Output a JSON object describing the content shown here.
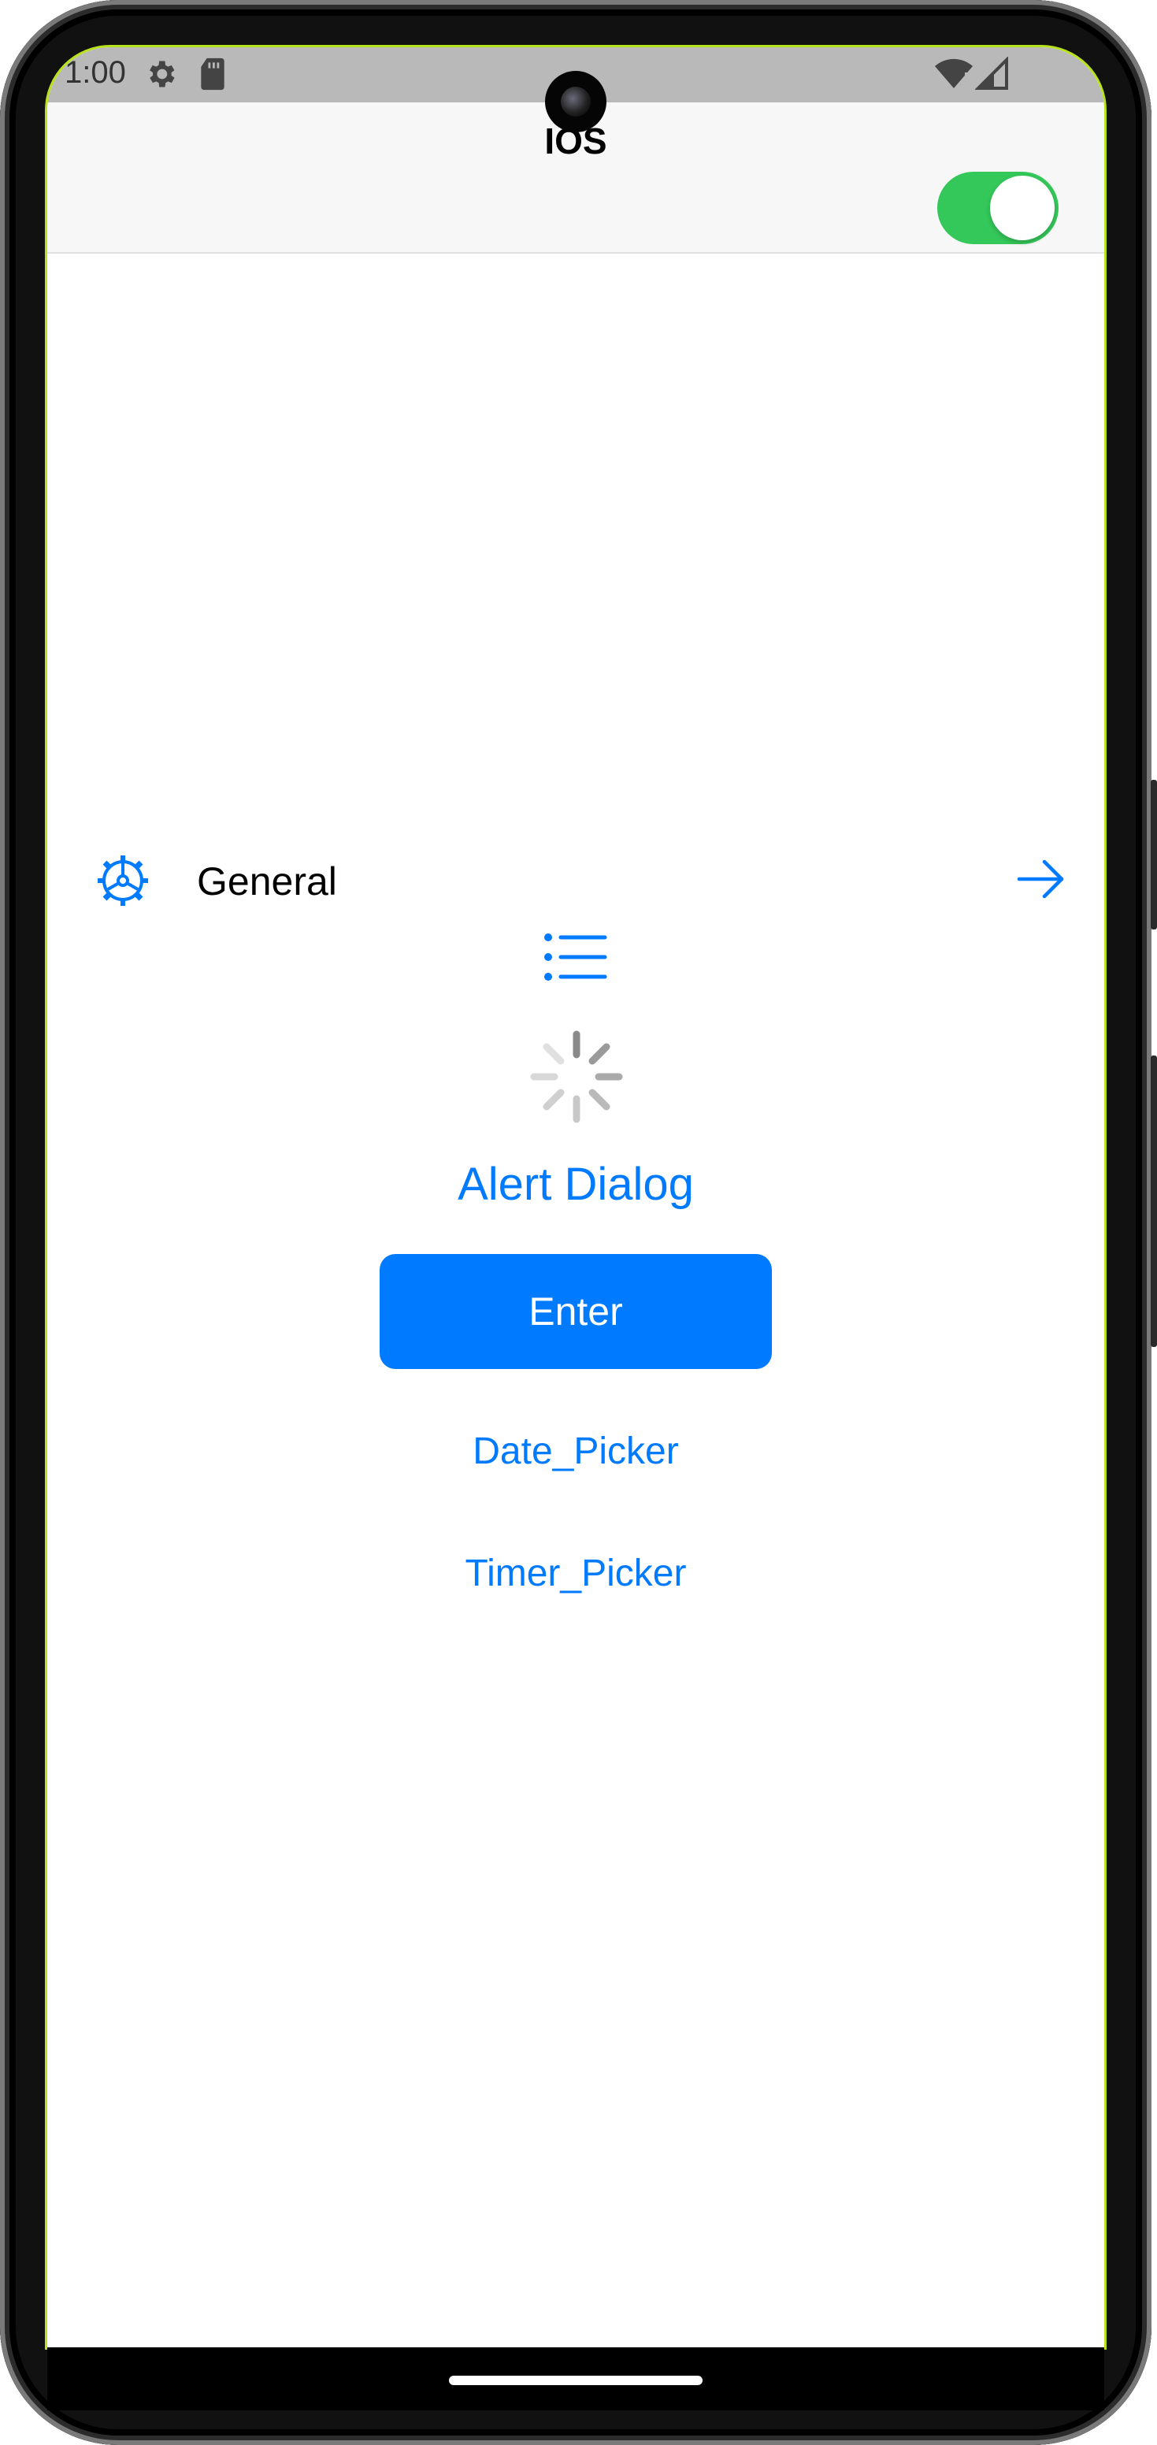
{
  "status_bar": {
    "time": "1:00",
    "icons": [
      "settings-icon",
      "sd-card-icon",
      "wifi-icon",
      "signal-icon"
    ]
  },
  "app_bar": {
    "title": "IOS",
    "toggle_on": true,
    "toggle_color": "#34c759"
  },
  "settings_row": {
    "icon": "gear-icon",
    "label": "General",
    "trailing_icon": "arrow-right-icon"
  },
  "content": {
    "list_icon": "list-icon",
    "spinner_icon": "activity-indicator",
    "alert_dialog_label": "Alert Dialog",
    "enter_button_label": "Enter",
    "date_picker_label": "Date_Picker",
    "timer_picker_label": "Timer_Picker"
  },
  "colors": {
    "accent": "#007aff",
    "toggle": "#34c759",
    "status_bar_bg": "#b9b9b9"
  }
}
